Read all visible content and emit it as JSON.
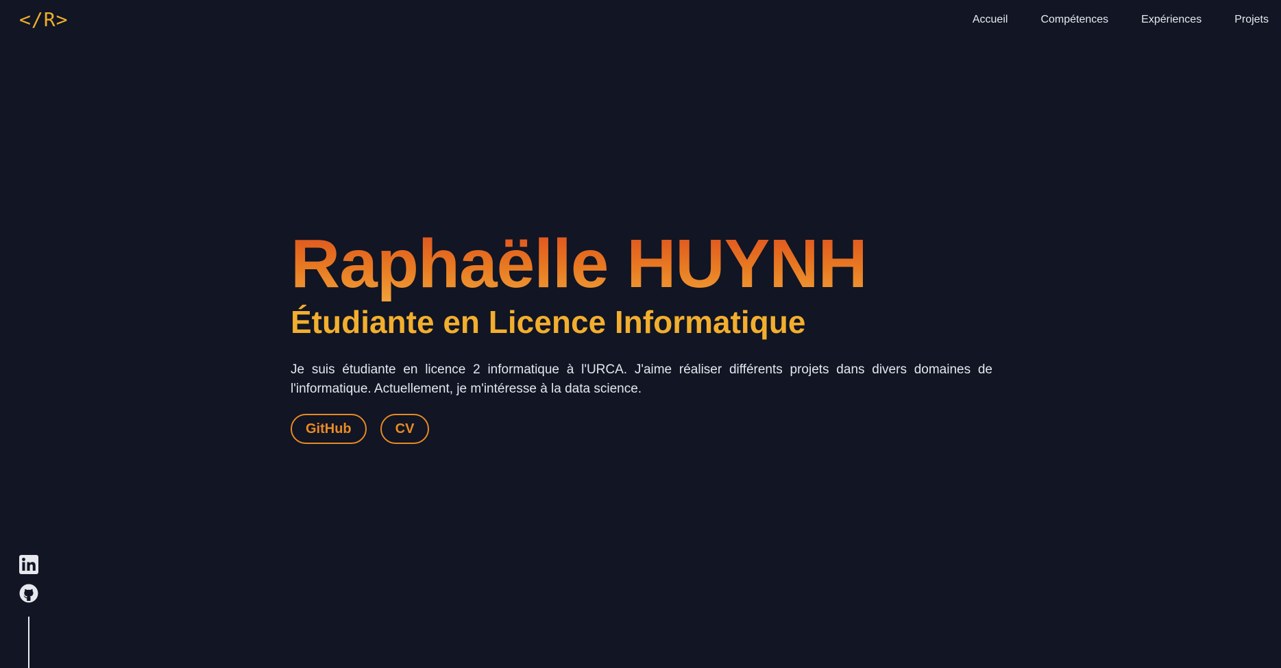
{
  "header": {
    "logo": "</R>",
    "nav": [
      "Accueil",
      "Compétences",
      "Expériences",
      "Projets"
    ]
  },
  "hero": {
    "name": "Raphaëlle HUYNH",
    "subtitle": "Étudiante en Licence Informatique",
    "intro": "Je suis étudiante en licence 2 informatique à l'URCA. J'aime réaliser différents projets dans divers domaines de l'informatique. Actuellement, je m'intéresse à la data science.",
    "buttons": [
      "GitHub",
      "CV"
    ]
  },
  "socials": {
    "icons": [
      "linkedin-icon",
      "github-icon"
    ]
  },
  "colors": {
    "background": "#111524",
    "accent": "#f2ae2e",
    "gradient_start": "#dd4d1f",
    "gradient_end": "#f1a23a",
    "button": "#e98a24",
    "text": "#e5e7ee"
  }
}
